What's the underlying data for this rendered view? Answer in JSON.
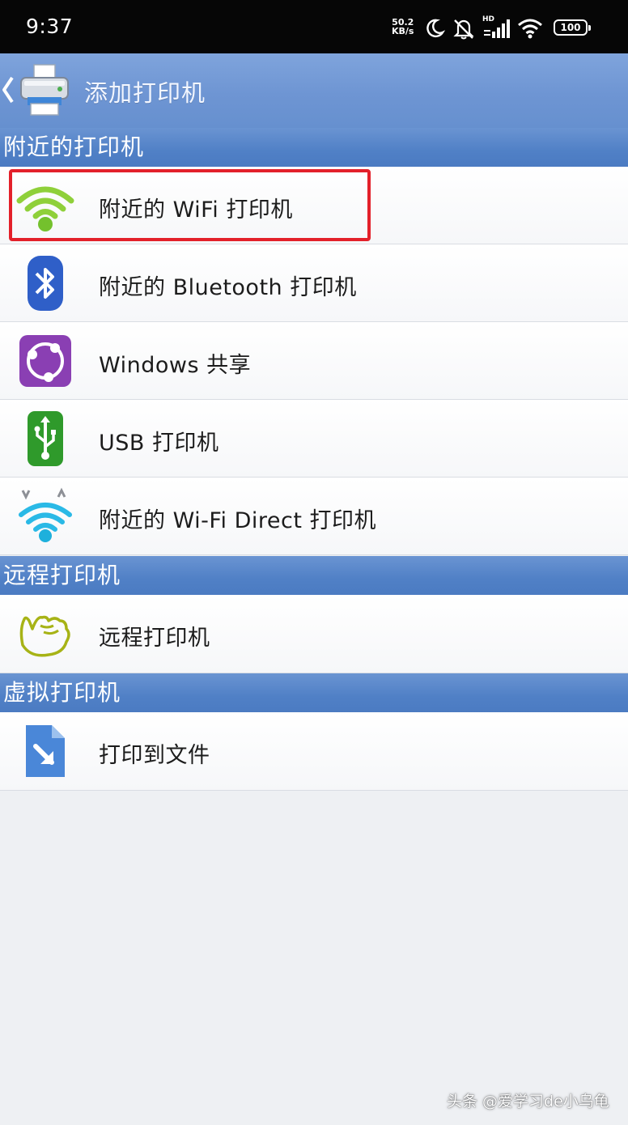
{
  "status_bar": {
    "time": "9:37",
    "net_speed_value": "50.2",
    "net_speed_unit": "KB/s",
    "network_label": "HD",
    "battery": "100"
  },
  "header": {
    "title": "添加打印机"
  },
  "sections": [
    {
      "title": "附近的打印机",
      "items": [
        {
          "label": "附近的 WiFi 打印机",
          "icon": "wifi-icon"
        },
        {
          "label": "附近的 Bluetooth 打印机",
          "icon": "bluetooth-icon"
        },
        {
          "label": "Windows 共享",
          "icon": "share-icon"
        },
        {
          "label": "USB 打印机",
          "icon": "usb-icon"
        },
        {
          "label": "附近的 Wi-Fi Direct 打印机",
          "icon": "wifi-direct-icon"
        }
      ]
    },
    {
      "title": "远程打印机",
      "items": [
        {
          "label": "远程打印机",
          "icon": "cloud-hand-icon"
        }
      ]
    },
    {
      "title": "虚拟打印机",
      "items": [
        {
          "label": "打印到文件",
          "icon": "file-export-icon"
        }
      ]
    }
  ],
  "colors": {
    "header": "#6e95d3",
    "section": "#5080c6",
    "highlight": "#e3202a"
  },
  "watermark": "头条 @爱学习de小乌龟"
}
